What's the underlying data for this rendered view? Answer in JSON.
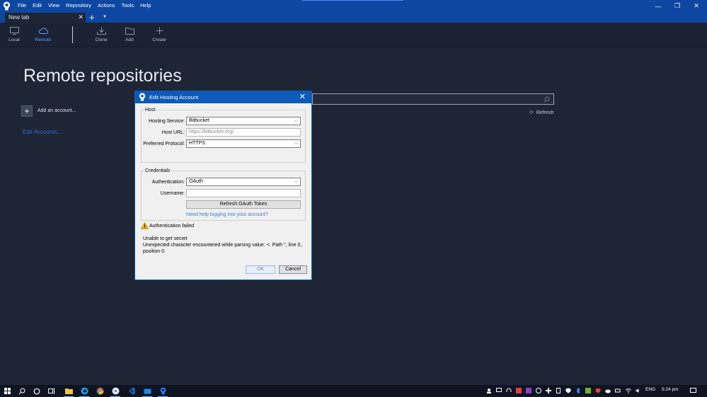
{
  "menu": [
    "File",
    "Edit",
    "View",
    "Repository",
    "Actions",
    "Tools",
    "Help"
  ],
  "window_controls": {
    "minimize": "—",
    "restore": "❐",
    "close": "✕"
  },
  "tab": {
    "title": "New tab",
    "close": "✕",
    "add": "+",
    "dropdown": "▼"
  },
  "toolbar": [
    {
      "label": "Local",
      "icon": "monitor-icon",
      "active": false
    },
    {
      "label": "Remote",
      "icon": "cloud-icon",
      "active": true
    },
    {
      "label": "Clone",
      "icon": "download-icon",
      "active": false
    },
    {
      "label": "Add",
      "icon": "folder-icon",
      "active": false
    },
    {
      "label": "Create",
      "icon": "plus-icon",
      "active": false
    }
  ],
  "main": {
    "title": "Remote repositories",
    "add_account_symbol": "+",
    "add_account_label": "Add an account...",
    "edit_accounts_link": "Edit Accounts...",
    "search_value": "",
    "refresh_label": "Refresh",
    "refresh_icon": "⟳"
  },
  "dialog": {
    "title": "Edit Hosting Account",
    "close": "✕",
    "host": {
      "legend": "Host",
      "service_label": "Hosting Service:",
      "service_value": "Bitbucket",
      "url_label": "Host URL:",
      "url_value": "https://bitbucket.org/",
      "protocol_label": "Preferred Protocol:",
      "protocol_value": "HTTPS"
    },
    "credentials": {
      "legend": "Credentials",
      "auth_label": "Authentication:",
      "auth_value": "OAuth",
      "username_label": "Username:",
      "username_value": "",
      "refresh_token_button": "Refresh OAuth Token",
      "help_link": "Need help logging into your account?"
    },
    "status": "Authentication failed",
    "error_line1": "Unable to get secret",
    "error_line2": "Unexpected character encountered while parsing value: <. Path '', line 0, position 0.",
    "ok_button": "OK",
    "cancel_button": "Cancel",
    "chevron": "⌵"
  },
  "taskbar": {
    "language": "ENG",
    "time": "5:24 pm"
  },
  "colors": {
    "title_bar": "#0d47a1",
    "background": "#1e2535",
    "accent": "#5aa0ff",
    "link": "#2f6fd4",
    "dialog_title": "#0d5ab8"
  }
}
